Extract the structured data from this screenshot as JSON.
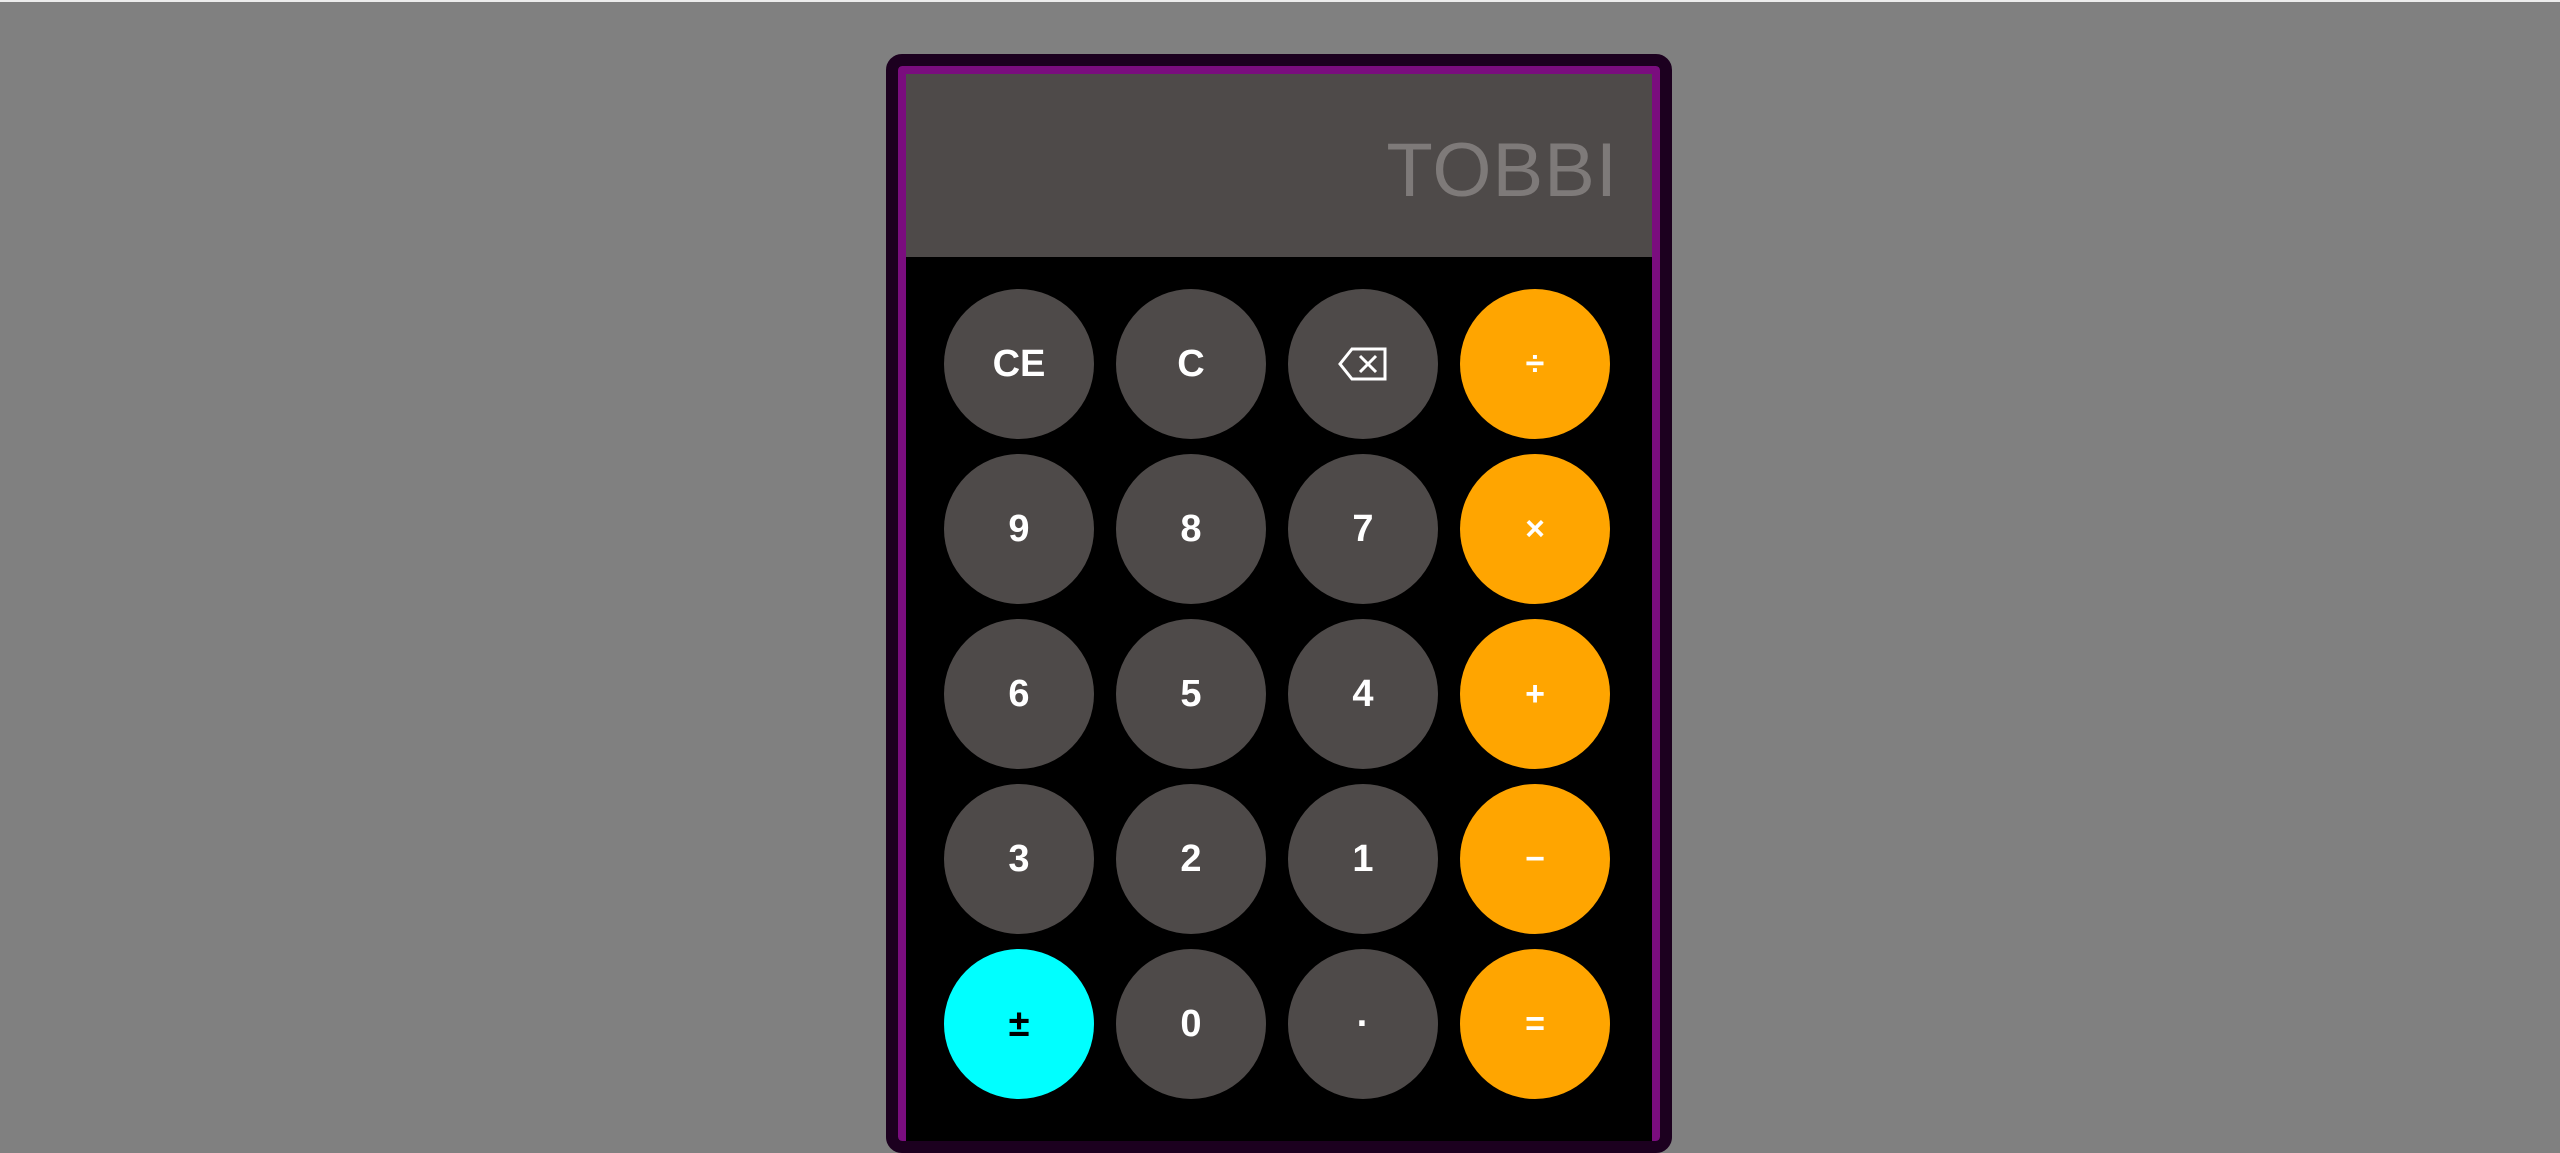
{
  "colors": {
    "page_background": "#808080",
    "frame_border": "#7a0d7e",
    "display_background": "#4e4a49",
    "display_text": "#7e7a79",
    "digit_key": "#4e4a49",
    "operator_key": "#ffa500",
    "plus_minus_key": "#00ffff"
  },
  "display": {
    "value": "TOBBI"
  },
  "keys": {
    "ce": "CE",
    "c": "C",
    "backspace_icon": "backspace-icon",
    "divide": "÷",
    "nine": "9",
    "eight": "8",
    "seven": "7",
    "multiply": "×",
    "six": "6",
    "five": "5",
    "four": "4",
    "plus": "+",
    "three": "3",
    "two": "2",
    "one": "1",
    "minus": "−",
    "plus_minus": "±",
    "zero": "0",
    "decimal": "·",
    "equals": "="
  }
}
